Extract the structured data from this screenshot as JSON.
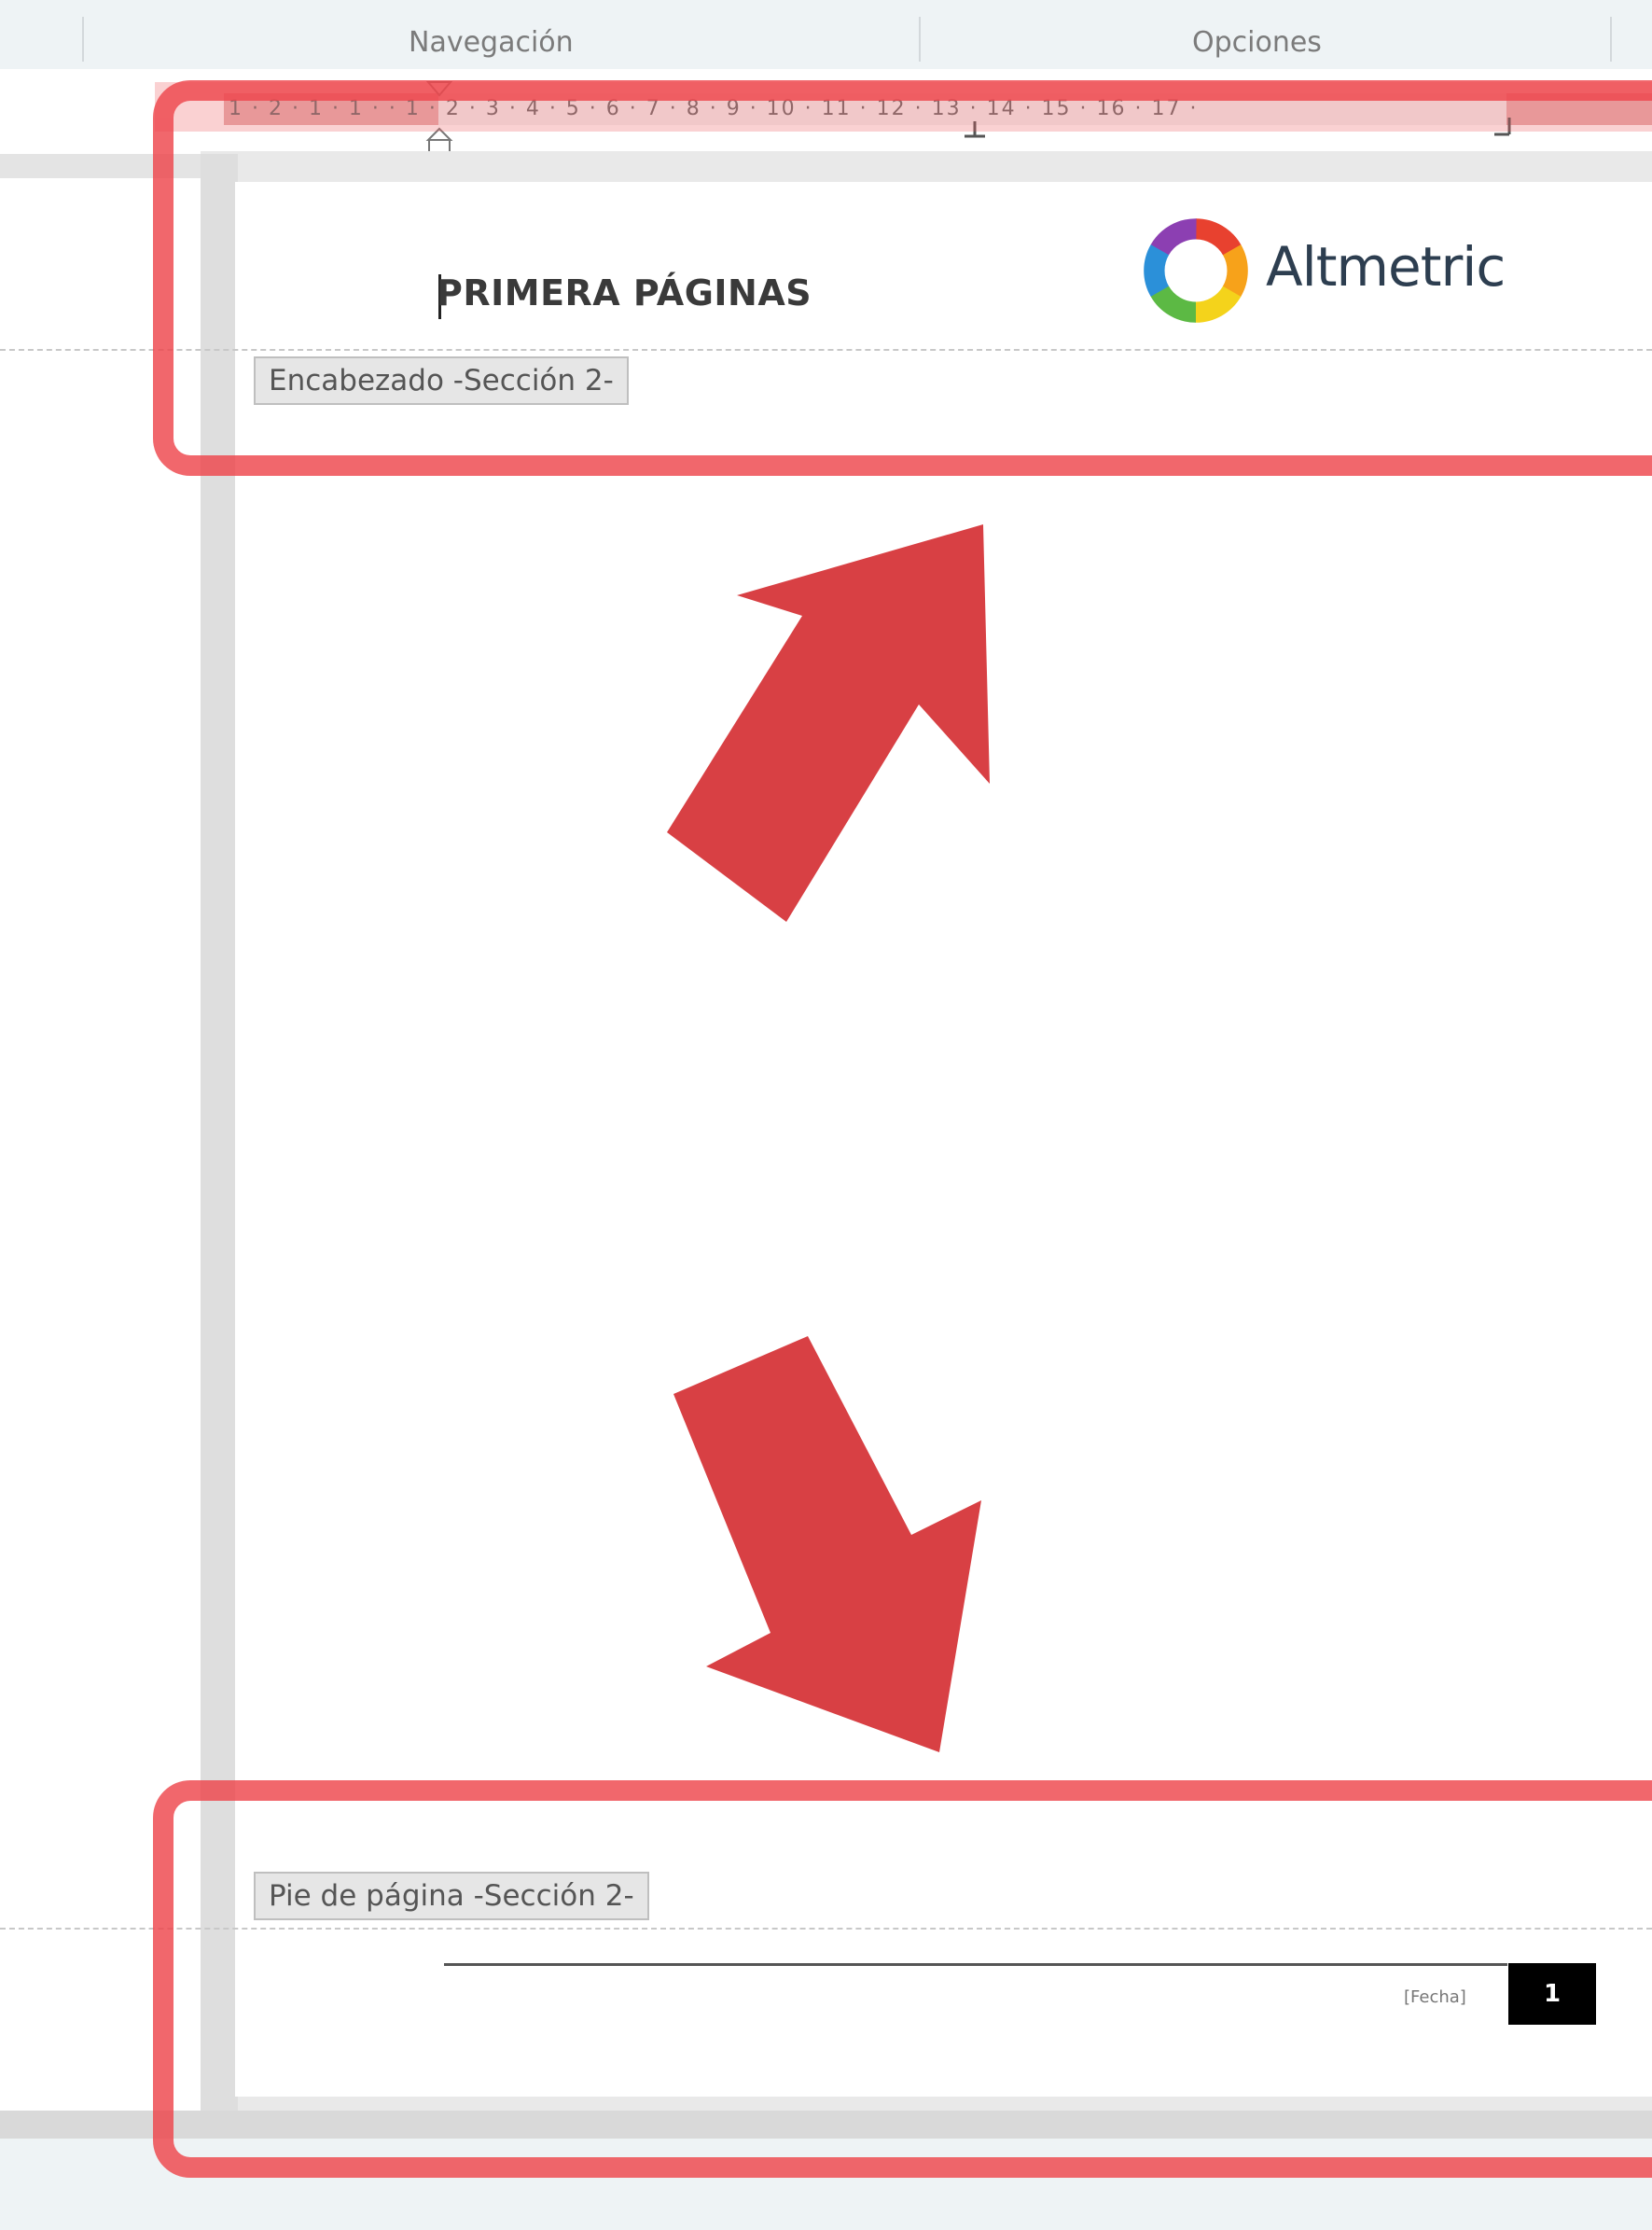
{
  "ribbon": {
    "groups": [
      {
        "label": "Navegación"
      },
      {
        "label": "Opciones"
      }
    ]
  },
  "ruler": {
    "ticks": "1 · 2 · 1 · 1 ·  · 1 · 2 · 3 · 4 · 5 · 6 · 7 · 8 · 9 · 10 · 11 · 12 · 13 · 14 · 15 · 16 · 17 ·"
  },
  "header": {
    "title": "PRIMERA PÁGINAS",
    "section_tag": "Encabezado -Sección 2-",
    "logo_text": "Altmetric"
  },
  "footer": {
    "section_tag": "Pie de página -Sección 2-",
    "date_placeholder": "[Fecha]",
    "page_number": "1"
  },
  "colors": {
    "highlight": "#ee464c",
    "arrow": "#d84044",
    "logo_text": "#2d3e50"
  }
}
